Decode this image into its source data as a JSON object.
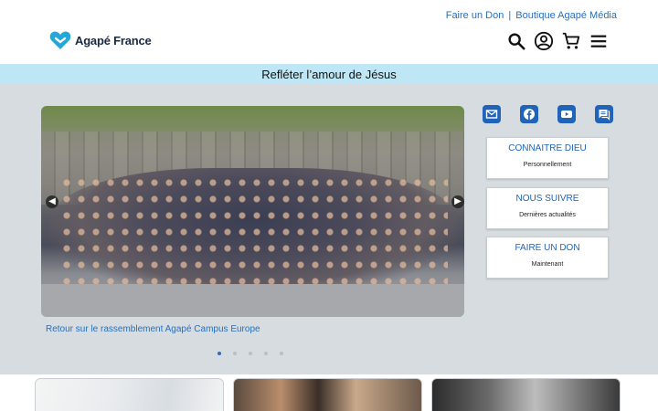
{
  "toplinks": {
    "don": "Faire un Don",
    "sep": "|",
    "boutique": "Boutique Agapé Média"
  },
  "brand": {
    "name": "Agapé France",
    "color": "#25a8d8"
  },
  "header": {
    "icons": [
      "search-icon",
      "account-icon",
      "cart-icon",
      "menu-icon"
    ]
  },
  "tagline": "Refléter l’amour de Jésus",
  "carousel": {
    "caption": "Retour sur le rassemblement Agapé Campus Europe",
    "slides": 5,
    "active_slide": 1
  },
  "social": [
    "mail-icon",
    "facebook-icon",
    "youtube-icon",
    "chat-icon"
  ],
  "cta": [
    {
      "title": "CONNAITRE DIEU",
      "sub": "Personnellement"
    },
    {
      "title": "NOUS SUIVRE",
      "sub": "Dernières actualités"
    },
    {
      "title": "FAIRE UN DON",
      "sub": "Maintenant"
    }
  ],
  "colors": {
    "accent": "#1f64b8",
    "tagline_bg": "#bfe6f4",
    "main_bg": "#d6dcdf"
  }
}
